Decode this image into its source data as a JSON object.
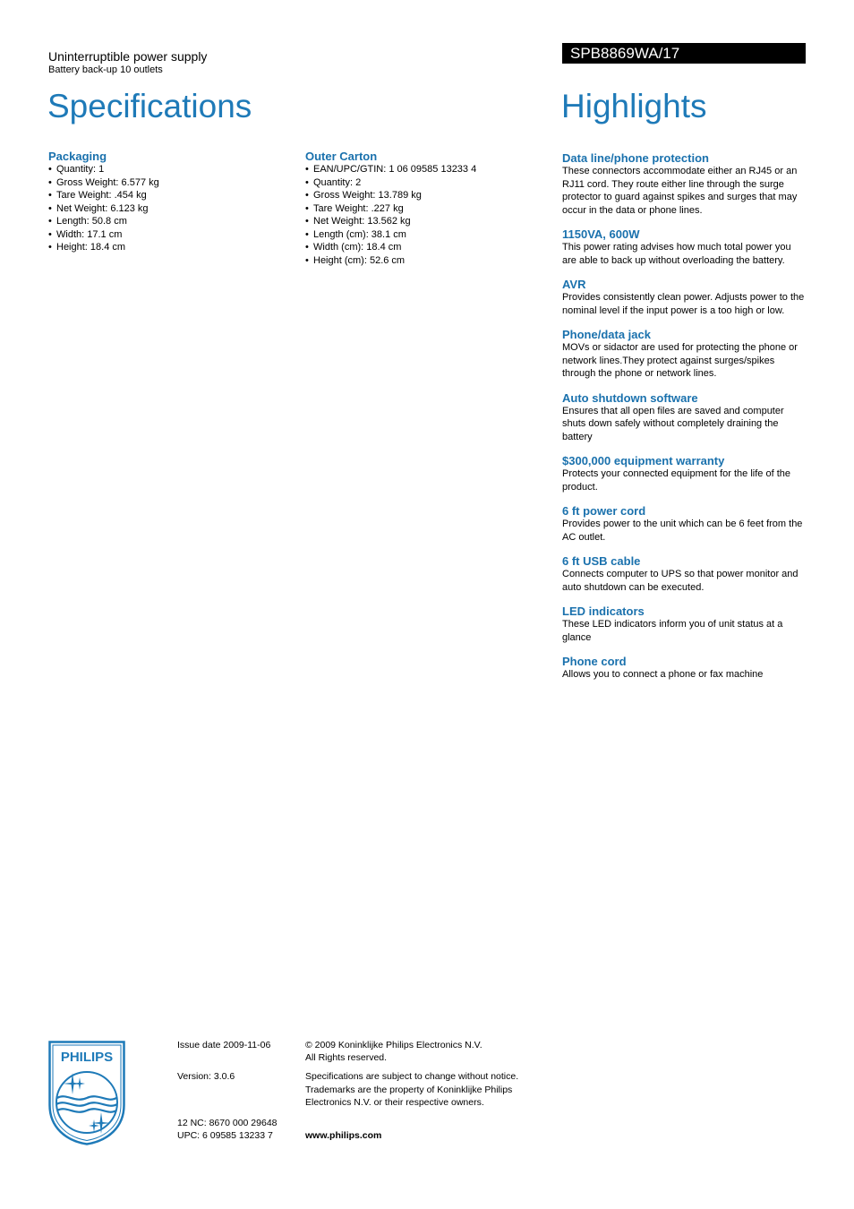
{
  "header": {
    "product_type": "Uninterruptible power supply",
    "product_subtitle": "Battery back-up 10 outlets",
    "model_number": "SPB8869WA/17",
    "specifications_title": "Specifications",
    "highlights_title": "Highlights"
  },
  "specifications": {
    "packaging": {
      "title": "Packaging",
      "items": [
        "Quantity: 1",
        "Gross Weight: 6.577 kg",
        "Tare Weight: .454 kg",
        "Net Weight: 6.123 kg",
        "Length: 50.8 cm",
        "Width: 17.1 cm",
        "Height: 18.4 cm"
      ]
    },
    "outer_carton": {
      "title": "Outer Carton",
      "items": [
        "EAN/UPC/GTIN: 1 06 09585 13233 4",
        "Quantity: 2",
        "Gross Weight: 13.789 kg",
        "Tare Weight: .227 kg",
        "Net Weight: 13.562 kg",
        "Length (cm): 38.1 cm",
        "Width (cm): 18.4 cm",
        "Height (cm): 52.6 cm"
      ]
    }
  },
  "highlights": [
    {
      "title": "Data line/phone protection",
      "text": "These connectors accommodate either an RJ45 or an RJ11 cord. They route either line through the surge protector to guard against spikes and surges that may occur in the data or phone lines."
    },
    {
      "title": "1150VA, 600W",
      "text": "This power rating advises how much total power you are able to back up without overloading the battery."
    },
    {
      "title": "AVR",
      "text": "Provides consistently clean power. Adjusts power to the nominal level if the input power is a too high or low."
    },
    {
      "title": "Phone/data jack",
      "text": "MOVs or sidactor are used for protecting the phone or network lines.They protect against surges/spikes through the phone or network lines."
    },
    {
      "title": "Auto shutdown software",
      "text": "Ensures that all open files are saved and computer shuts down safely without completely draining the battery"
    },
    {
      "title": "$300,000 equipment warranty",
      "text": "Protects your connected equipment for the life of the product."
    },
    {
      "title": "6 ft power cord",
      "text": "Provides power to the unit which can be 6 feet from the AC outlet."
    },
    {
      "title": "6 ft USB cable",
      "text": "Connects computer to UPS so that power monitor and auto shutdown can be executed."
    },
    {
      "title": "LED indicators",
      "text": "These LED indicators inform you of unit status at a glance"
    },
    {
      "title": "Phone cord",
      "text": "Allows you to connect a phone or fax machine"
    }
  ],
  "footer": {
    "logo_text": "PHILIPS",
    "issue_date": "Issue date 2009-11-06",
    "version": "Version: 3.0.6",
    "nc": "12 NC: 8670 000 29648",
    "upc": "UPC: 6 09585 13233 7",
    "copyright": "© 2009 Koninklijke Philips Electronics N.V.",
    "rights": "All Rights reserved.",
    "disclaimer": "Specifications are subject to change without notice. Trademarks are the property of Koninklijke Philips Electronics N.V. or their respective owners.",
    "website": "www.philips.com"
  },
  "colors": {
    "accent_blue": "#1e7ab8",
    "model_bar": "#000000"
  }
}
